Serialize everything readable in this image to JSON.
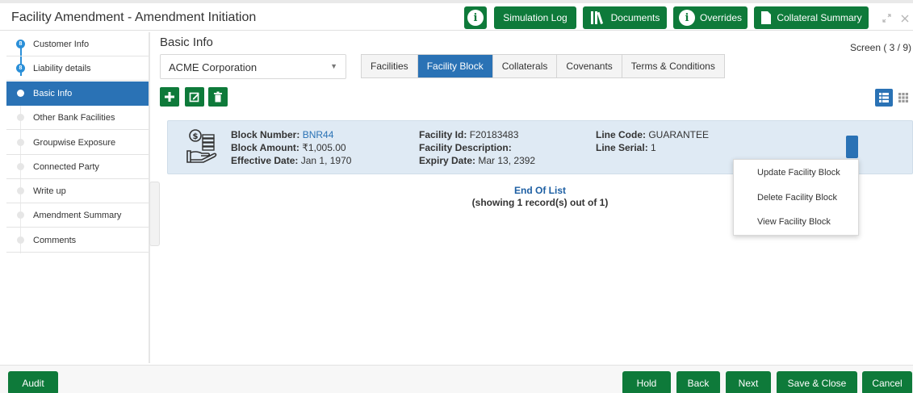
{
  "header": {
    "title": "Facility Amendment - Amendment Initiation",
    "buttons": {
      "simulation_log": "Simulation Log",
      "documents": "Documents",
      "overrides": "Overrides",
      "collateral_summary": "Collateral Summary"
    }
  },
  "sidebar": {
    "items": [
      {
        "label": "Customer Info",
        "state": "done"
      },
      {
        "label": "Liability details",
        "state": "done"
      },
      {
        "label": "Basic Info",
        "state": "active"
      },
      {
        "label": "Other Bank Facilities",
        "state": "pending"
      },
      {
        "label": "Groupwise Exposure",
        "state": "pending"
      },
      {
        "label": "Connected Party",
        "state": "pending"
      },
      {
        "label": "Write up",
        "state": "pending"
      },
      {
        "label": "Amendment Summary",
        "state": "pending"
      },
      {
        "label": "Comments",
        "state": "pending"
      }
    ]
  },
  "main": {
    "title": "Basic Info",
    "screen_indicator": "Screen ( 3 / 9)",
    "customer_select": {
      "value": "ACME Corporation"
    },
    "tabs": [
      {
        "label": "Facilities"
      },
      {
        "label": "Facility Block"
      },
      {
        "label": "Collaterals"
      },
      {
        "label": "Covenants"
      },
      {
        "label": "Terms & Conditions"
      }
    ],
    "active_tab": "Facility Block"
  },
  "card": {
    "block_number_label": "Block Number:",
    "block_number": "BNR44",
    "block_amount_label": "Block Amount:",
    "block_amount": "₹1,005.00",
    "effective_date_label": "Effective Date:",
    "effective_date": "Jan 1, 1970",
    "facility_id_label": "Facility Id:",
    "facility_id": "F20183483",
    "facility_description_label": "Facility Description:",
    "expiry_date_label": "Expiry Date:",
    "expiry_date": "Mar 13, 2392",
    "line_code_label": "Line Code:",
    "line_code": "GUARANTEE",
    "line_serial_label": "Line Serial:",
    "line_serial": "1"
  },
  "list_status": {
    "end_of_list": "End Of List",
    "record_count": "(showing 1 record(s) out of 1)"
  },
  "context_menu": {
    "items": [
      {
        "label": "Update Facility Block"
      },
      {
        "label": "Delete Facility Block"
      },
      {
        "label": "View Facility Block"
      }
    ]
  },
  "footer": {
    "audit": "Audit",
    "hold": "Hold",
    "back": "Back",
    "next": "Next",
    "save_close": "Save & Close",
    "cancel": "Cancel"
  },
  "colors": {
    "primary_green": "#0e7a3a",
    "active_blue": "#2a72b5",
    "card_bg": "#dfeaf4"
  },
  "icons": [
    "info-icon",
    "documents-icon",
    "collateral-icon",
    "minimize-icon",
    "close-icon",
    "add-icon",
    "edit-icon",
    "delete-icon",
    "list-view-icon",
    "grid-view-icon",
    "money-hand-icon",
    "chevron-down-icon"
  ]
}
